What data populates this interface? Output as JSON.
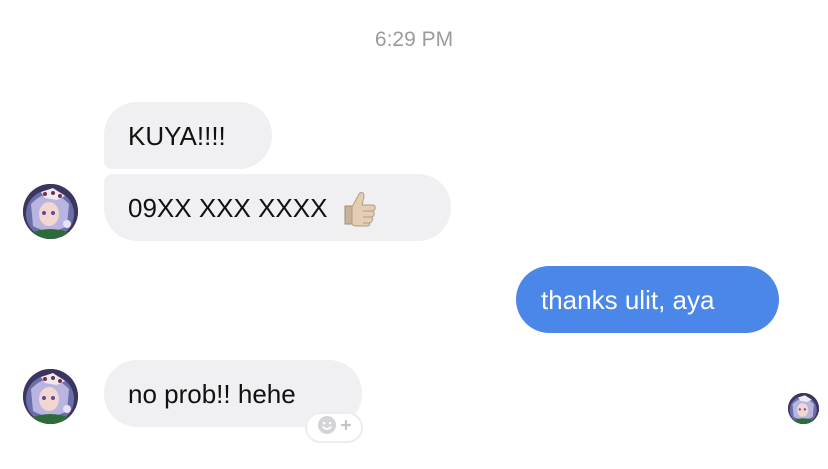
{
  "timestamp": "6:29 PM",
  "messages": [
    {
      "sender": "other",
      "text": "KUYA!!!!"
    },
    {
      "sender": "other",
      "text": "09XX XXX XXXX",
      "emoji": "thumbs-up-icon"
    },
    {
      "sender": "me",
      "text": "thanks ulit, aya"
    },
    {
      "sender": "other",
      "text": "no prob!! hehe"
    }
  ],
  "colors": {
    "incoming_bubble": "#f0f0f2",
    "outgoing_bubble": "#4b87e8",
    "timestamp_text": "#9b9b9f"
  },
  "icons": {
    "reaction_button": "add-reaction-icon",
    "avatar": "contact-avatar"
  }
}
